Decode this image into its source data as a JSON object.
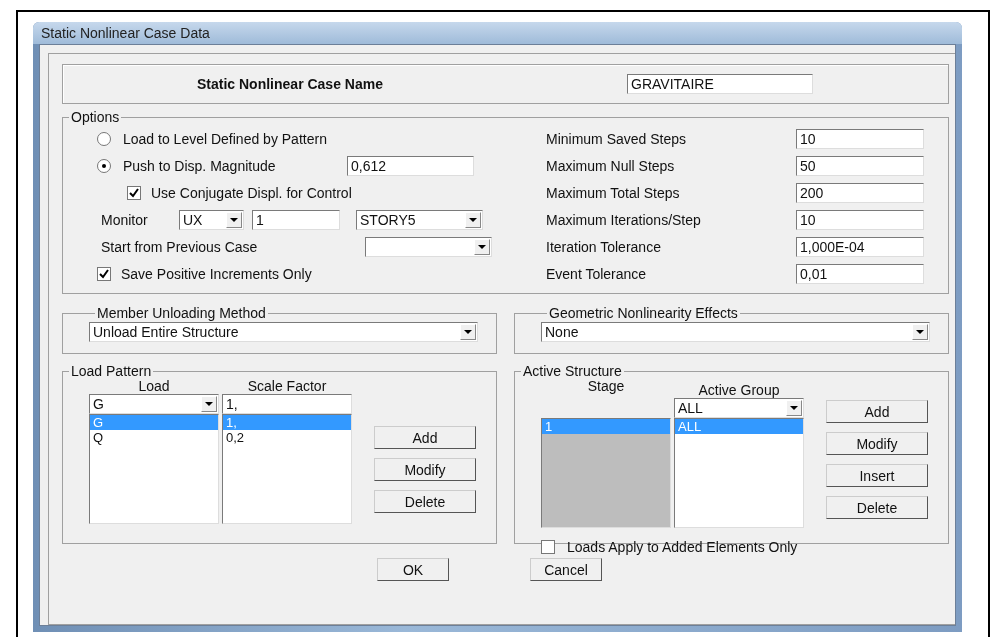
{
  "window": {
    "title": "Static Nonlinear Case Data"
  },
  "case_name": {
    "label": "Static Nonlinear Case Name",
    "value": "GRAVITAIRE"
  },
  "options": {
    "title": "Options",
    "radios": [
      {
        "label": "Load to Level Defined by Pattern",
        "selected": false
      },
      {
        "label": "Push to Disp. Magnitude",
        "selected": true
      }
    ],
    "push_value": "0,612",
    "conjugate": {
      "label": "Use Conjugate Displ. for Control",
      "checked": true
    },
    "monitor": {
      "label": "Monitor",
      "dof": "UX",
      "point": "1",
      "story": "STORY5"
    },
    "start_from": {
      "label": "Start from Previous Case"
    },
    "save_positive": {
      "label": "Save Positive Increments Only",
      "checked": true
    },
    "steps": [
      {
        "label": "Minimum Saved Steps",
        "value": "10"
      },
      {
        "label": "Maximum Null Steps",
        "value": "50"
      },
      {
        "label": "Maximum Total Steps",
        "value": "200"
      },
      {
        "label": "Maximum Iterations/Step",
        "value": "10"
      },
      {
        "label": "Iteration Tolerance",
        "value": "1,000E-04"
      },
      {
        "label": "Event Tolerance",
        "value": "0,01"
      }
    ]
  },
  "member_unloading": {
    "title": "Member Unloading Method",
    "value": "Unload Entire Structure"
  },
  "geometric": {
    "title": "Geometric Nonlinearity Effects",
    "value": "None"
  },
  "load_pattern": {
    "title": "Load Pattern",
    "columns": [
      "Load",
      "Scale Factor"
    ],
    "load_input": "G",
    "scale_input": "1,",
    "rows": [
      {
        "load": "G",
        "scale": "1,",
        "selected": true
      },
      {
        "load": "Q",
        "scale": "0,2",
        "selected": false
      }
    ],
    "buttons": [
      "Add",
      "Modify",
      "Delete"
    ]
  },
  "active_structure": {
    "title": "Active Structure",
    "stage_label": "Stage",
    "group_label": "Active Group",
    "group_input": "ALL",
    "rows": [
      {
        "stage": "1",
        "group": "ALL",
        "selected": true
      }
    ],
    "buttons": [
      "Add",
      "Modify",
      "Insert",
      "Delete"
    ],
    "loads_apply": {
      "label": "Loads Apply to Added Elements Only",
      "checked": false
    }
  },
  "buttons": [
    "OK",
    "Cancel"
  ]
}
